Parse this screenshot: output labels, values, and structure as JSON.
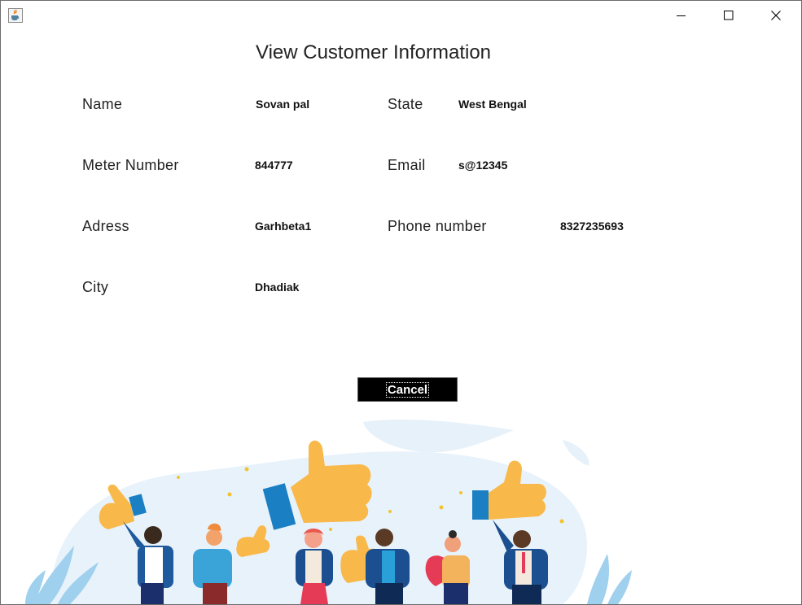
{
  "window": {
    "controls": {
      "minimize": "minimize-icon",
      "maximize": "maximize-icon",
      "close": "close-icon"
    },
    "app_icon": "java-cup-icon"
  },
  "heading": "View Customer Information",
  "fields": {
    "name": {
      "label": "Name",
      "value": "Sovan pal"
    },
    "meter": {
      "label": "Meter Number",
      "value": "844777"
    },
    "address": {
      "label": "Adress",
      "value": "Garhbeta1"
    },
    "city": {
      "label": "City",
      "value": "Dhadiak"
    },
    "state": {
      "label": "State",
      "value": "West Bengal"
    },
    "email": {
      "label": "Email",
      "value": "s@12345"
    },
    "phone": {
      "label": "Phone number",
      "value": "8327235693"
    }
  },
  "buttons": {
    "cancel": "Cancel"
  },
  "colors": {
    "thumb": "#f9b84a",
    "cuff": "#1b7fc4",
    "background_blob": "#e6f1fa",
    "button": "#000000"
  }
}
